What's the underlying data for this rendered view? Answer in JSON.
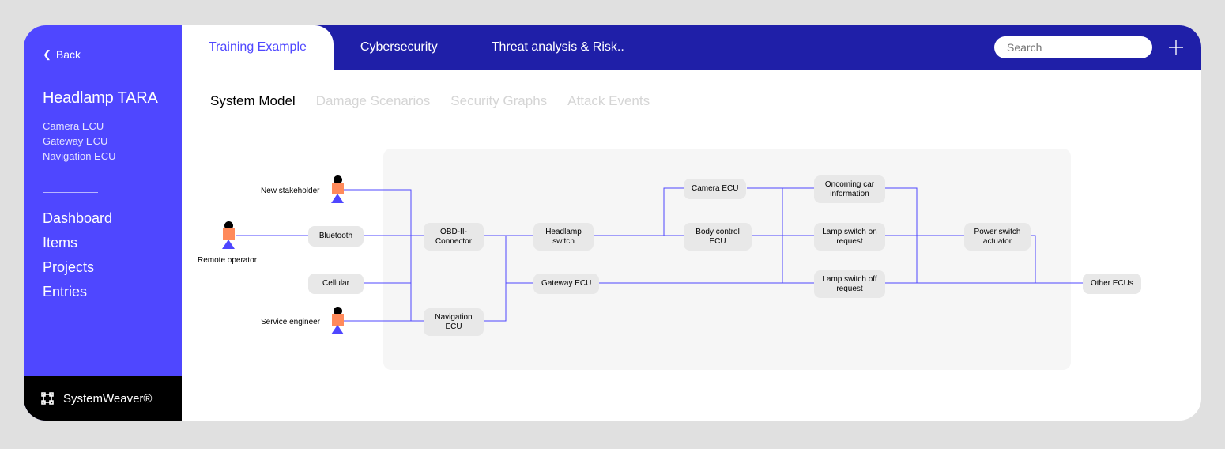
{
  "sidebar": {
    "back": "Back",
    "title": "Headlamp TARA",
    "subs": [
      "Camera ECU",
      "Gateway ECU",
      "Navigation ECU"
    ],
    "nav": [
      "Dashboard",
      "Items",
      "Projects",
      "Entries"
    ],
    "brand": "SystemWeaver®"
  },
  "topbar": {
    "tabs": [
      "Training Example",
      "Cybersecurity",
      "Threat analysis & Risk.."
    ],
    "search_placeholder": "Search"
  },
  "subtabs": [
    "System Model",
    "Damage Scenarios",
    "Security Graphs",
    "Attack Events"
  ],
  "actors": {
    "a1": "New stakeholder",
    "a2": "Remote operator",
    "a3": "Service engineer"
  },
  "nodes": {
    "bluetooth": "Bluetooth",
    "cellular": "Cellular",
    "obd": "OBD-II-Connector",
    "nav": "Navigation ECU",
    "headlamp": "Headlamp switch",
    "gateway": "Gateway ECU",
    "camera": "Camera ECU",
    "body": "Body control ECU",
    "oncoming": "Oncoming car information",
    "lampon": "Lamp switch on request",
    "lampoff": "Lamp switch off request",
    "power": "Power switch actuator",
    "other": "Other ECUs"
  },
  "colors": {
    "sidebar": "#4f47ff",
    "topbar": "#1f1fa8",
    "actor_square": "#ff8a5b",
    "line": "#4f47ff"
  }
}
